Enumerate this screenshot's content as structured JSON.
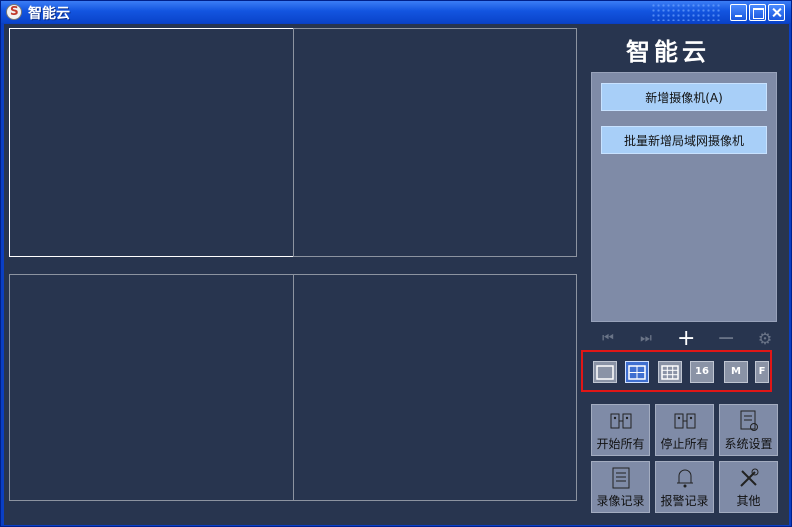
{
  "window": {
    "title": "智能云"
  },
  "panel": {
    "brand": "智能云",
    "add_camera": "新增摄像机(A)",
    "batch_add": "批量新增局域网摄像机"
  },
  "nav_icons": [
    "first-icon",
    "last-icon",
    "plus-icon",
    "minus-icon",
    "gear-icon"
  ],
  "layouts": [
    {
      "name": "layout-1",
      "label": ""
    },
    {
      "name": "layout-4",
      "label": ""
    },
    {
      "name": "layout-9",
      "label": ""
    },
    {
      "name": "layout-16",
      "label": "16"
    },
    {
      "name": "layout-m",
      "label": "M"
    },
    {
      "name": "layout-f",
      "label": "F"
    }
  ],
  "functions": {
    "start_all": "开始所有",
    "stop_all": "停止所有",
    "settings": "系统设置",
    "recordings": "录像记录",
    "alarms": "报警记录",
    "other": "其他"
  },
  "colors": {
    "background": "#28354f",
    "panel": "#7f8ba7",
    "button": "#a8cff8",
    "highlight": "#e01616",
    "titlebar": "#1355e0"
  }
}
